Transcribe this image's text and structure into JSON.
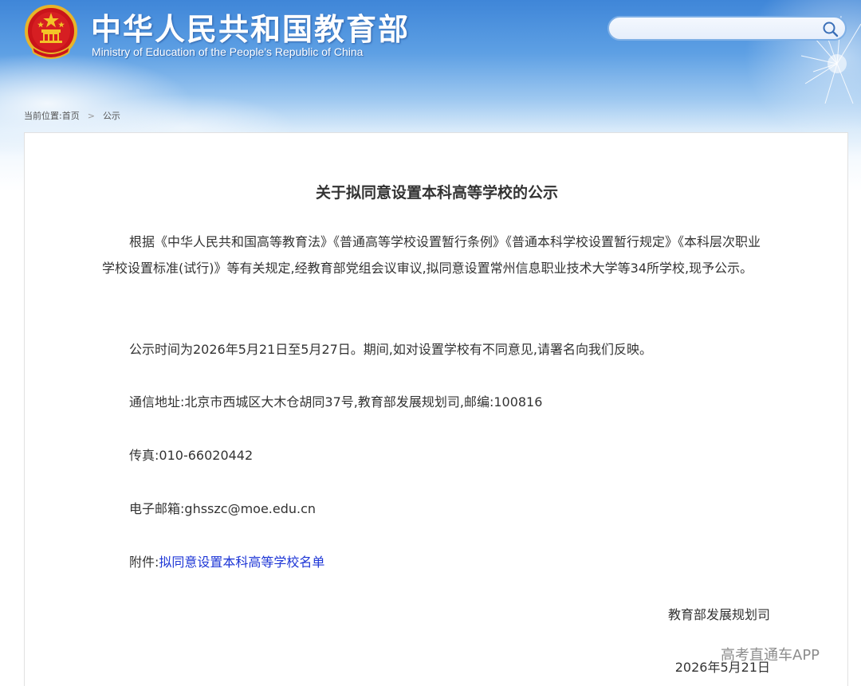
{
  "header": {
    "site_title": "中华人民共和国教育部",
    "site_subtitle": "Ministry of Education of the People's Republic of China",
    "emblem_icon": "national-emblem-icon",
    "search": {
      "placeholder": "",
      "value": "",
      "icon": "search-icon"
    }
  },
  "breadcrumb": {
    "prefix": "当前位置:",
    "home": "首页",
    "separator_icon": "chevron-right-icon",
    "current": "公示"
  },
  "article": {
    "title": "关于拟同意设置本科高等学校的公示",
    "paragraph_1": "根据《中华人民共和国高等教育法》《普通高等学校设置暂行条例》《普通本科学校设置暂行规定》《本科层次职业学校设置标准(试行)》等有关规定,经教育部党组会议审议,拟同意设置常州信息职业技术大学等34所学校,现予公示。",
    "paragraph_2": "公示时间为2026年5月21日至5月27日。期间,如对设置学校有不同意见,请署名向我们反映。",
    "address_label": "通信地址:",
    "address_value": "北京市西城区大木仓胡同37号,教育部发展规划司,邮编:100816",
    "fax_label": "传真:",
    "fax_value": "010-66020442",
    "email_label": "电子邮箱:",
    "email_value": "ghsszc@moe.edu.cn",
    "attachment_label": "附件:",
    "attachment_link": "拟同意设置本科高等学校名单",
    "signature": "教育部发展规划司",
    "date": "2026年5月21日"
  },
  "watermark": "高考直通车APP",
  "colors": {
    "link": "#1d36d6",
    "banner_top": "#3f86d8",
    "text": "#333333"
  }
}
